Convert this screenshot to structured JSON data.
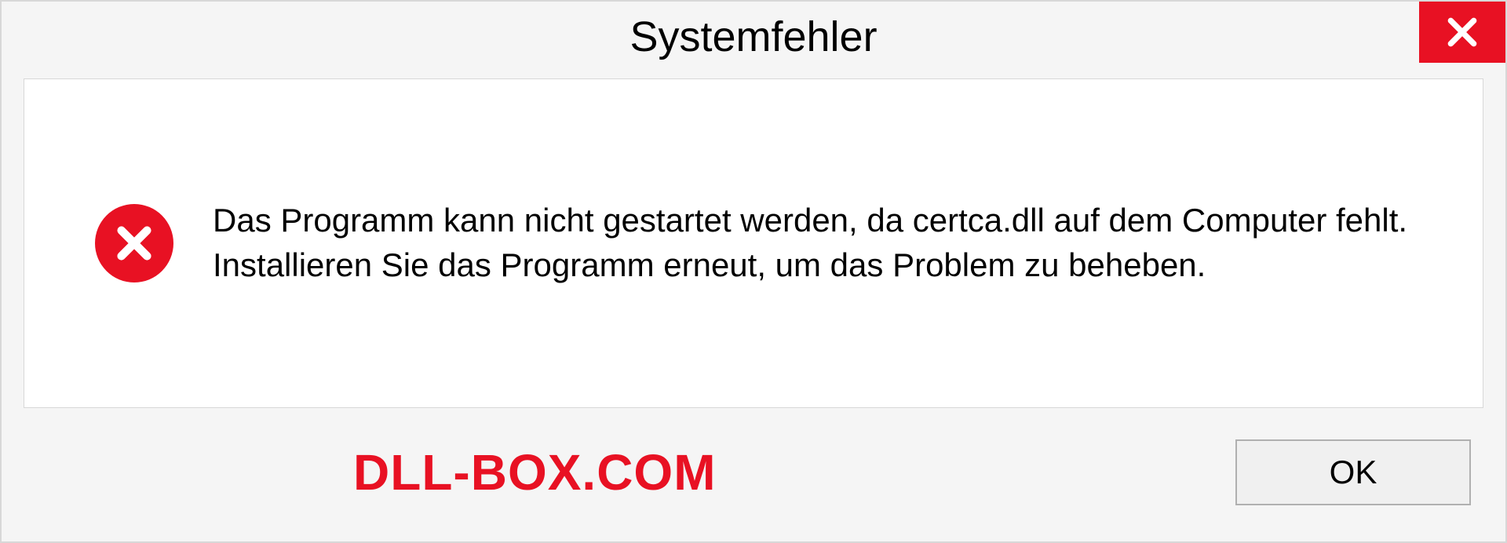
{
  "dialog": {
    "title": "Systemfehler",
    "message": "Das Programm kann nicht gestartet werden, da certca.dll auf dem Computer fehlt. Installieren Sie das Programm erneut, um das Problem zu beheben.",
    "ok_label": "OK"
  },
  "watermark": "DLL-BOX.COM"
}
